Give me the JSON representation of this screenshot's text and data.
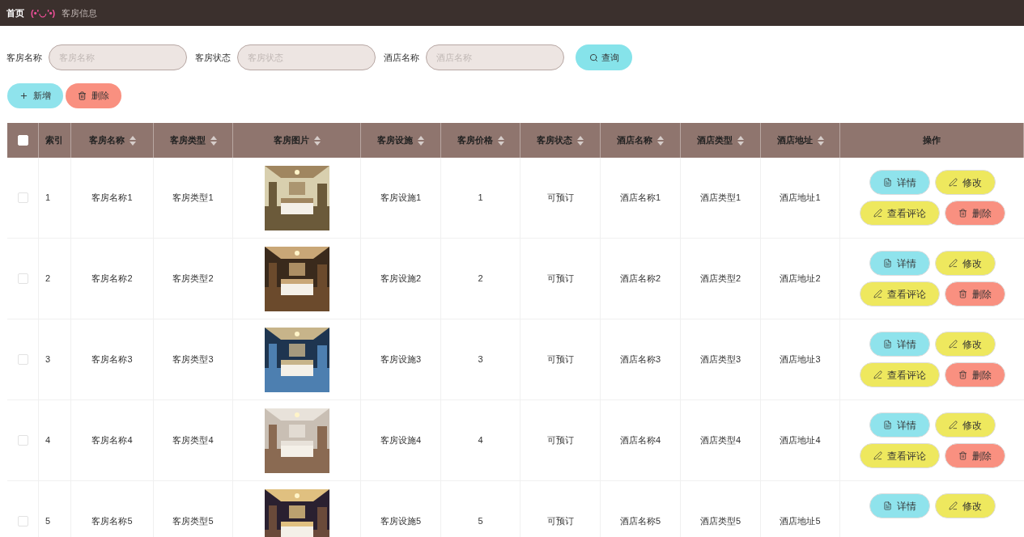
{
  "breadcrumb": {
    "home": "首页",
    "emoticon": "(•'◡'•)",
    "current": "客房信息"
  },
  "search": {
    "fields": [
      {
        "label": "客房名称",
        "placeholder": "客房名称"
      },
      {
        "label": "客房状态",
        "placeholder": "客房状态"
      },
      {
        "label": "酒店名称",
        "placeholder": "酒店名称"
      }
    ],
    "button": "查询"
  },
  "toolbar": [
    {
      "kind": "add",
      "label": "新增"
    },
    {
      "kind": "delete",
      "label": "删除"
    }
  ],
  "table": {
    "select_all": {
      "checked": false
    },
    "columns": [
      {
        "label": "索引",
        "sortable": false
      },
      {
        "label": "客房名称",
        "sortable": true
      },
      {
        "label": "客房类型",
        "sortable": true
      },
      {
        "label": "客房图片",
        "sortable": true
      },
      {
        "label": "客房设施",
        "sortable": true
      },
      {
        "label": "客房价格",
        "sortable": true
      },
      {
        "label": "客房状态",
        "sortable": true
      },
      {
        "label": "酒店名称",
        "sortable": true
      },
      {
        "label": "酒店类型",
        "sortable": true
      },
      {
        "label": "酒店地址",
        "sortable": true
      },
      {
        "label": "操作",
        "sortable": false
      }
    ],
    "rows": [
      {
        "checked": false,
        "cells": [
          "1",
          "客房名称1",
          "客房类型1",
          {
            "kind": "picture"
          },
          "客房设施1",
          "1",
          "可预订",
          "酒店名称1",
          "酒店类型1",
          "酒店地址1"
        ],
        "actions": [
          {
            "kind": "detail",
            "label": "详情"
          },
          {
            "kind": "edit",
            "label": "修改"
          },
          {
            "kind": "review",
            "label": "查看评论"
          },
          {
            "kind": "delete",
            "label": "删除"
          }
        ]
      },
      {
        "checked": false,
        "cells": [
          "2",
          "客房名称2",
          "客房类型2",
          {
            "kind": "picture"
          },
          "客房设施2",
          "2",
          "可预订",
          "酒店名称2",
          "酒店类型2",
          "酒店地址2"
        ],
        "actions": [
          {
            "kind": "detail",
            "label": "详情"
          },
          {
            "kind": "edit",
            "label": "修改"
          },
          {
            "kind": "review",
            "label": "查看评论"
          },
          {
            "kind": "delete",
            "label": "删除"
          }
        ]
      },
      {
        "checked": false,
        "cells": [
          "3",
          "客房名称3",
          "客房类型3",
          {
            "kind": "picture"
          },
          "客房设施3",
          "3",
          "可预订",
          "酒店名称3",
          "酒店类型3",
          "酒店地址3"
        ],
        "actions": [
          {
            "kind": "detail",
            "label": "详情"
          },
          {
            "kind": "edit",
            "label": "修改"
          },
          {
            "kind": "review",
            "label": "查看评论"
          },
          {
            "kind": "delete",
            "label": "删除"
          }
        ]
      },
      {
        "checked": false,
        "cells": [
          "4",
          "客房名称4",
          "客房类型4",
          {
            "kind": "picture"
          },
          "客房设施4",
          "4",
          "可预订",
          "酒店名称4",
          "酒店类型4",
          "酒店地址4"
        ],
        "actions": [
          {
            "kind": "detail",
            "label": "详情"
          },
          {
            "kind": "edit",
            "label": "修改"
          },
          {
            "kind": "review",
            "label": "查看评论"
          },
          {
            "kind": "delete",
            "label": "删除"
          }
        ]
      },
      {
        "checked": false,
        "cells": [
          "5",
          "客房名称5",
          "客房类型5",
          {
            "kind": "picture"
          },
          "客房设施5",
          "5",
          "可预订",
          "酒店名称5",
          "酒店类型5",
          "酒店地址5"
        ],
        "actions": [
          {
            "kind": "detail",
            "label": "详情"
          },
          {
            "kind": "edit",
            "label": "修改"
          }
        ]
      }
    ]
  }
}
